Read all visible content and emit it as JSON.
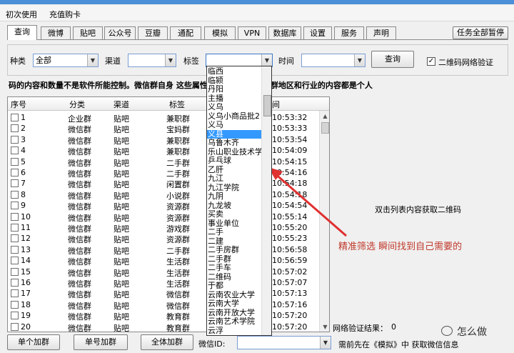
{
  "menu": [
    "初次使用",
    "充值购卡"
  ],
  "tabs": [
    "查询",
    "微博",
    "贴吧",
    "公众号",
    "豆瓣",
    "通配",
    "模拟",
    "VPN",
    "数据库",
    "设置",
    "服务",
    "声明"
  ],
  "pause_all_button": "任务全部暂停",
  "filters": {
    "type_label": "种类",
    "type_value": "全部",
    "channel_label": "渠道",
    "channel_value": "",
    "tag_label": "标签",
    "tag_value": "",
    "time_label": "时间",
    "time_value": "",
    "query_button": "查询",
    "qr_verify_label": "二维码网络验证",
    "qr_verify_checked": true
  },
  "notice": "码的内容和数量不是软件所能控制。微信群自身 这些属性标记的，那些标记群地区和行业的内容都是个人",
  "table": {
    "headers": [
      "序号",
      "分类",
      "渠道",
      "标签",
      "间"
    ],
    "rows": [
      [
        "1",
        "企业群",
        "贴吧",
        "兼职群",
        "10:53:32"
      ],
      [
        "2",
        "微信群",
        "贴吧",
        "宝妈群",
        "10:53:33"
      ],
      [
        "3",
        "微信群",
        "贴吧",
        "兼职群",
        "10:53:54"
      ],
      [
        "4",
        "微信群",
        "贴吧",
        "兼职群",
        "10:54:09"
      ],
      [
        "5",
        "微信群",
        "贴吧",
        "二手群",
        "10:54:15"
      ],
      [
        "6",
        "微信群",
        "贴吧",
        "二手群",
        "10:54:16"
      ],
      [
        "7",
        "微信群",
        "贴吧",
        "闲置群",
        "10:54:18"
      ],
      [
        "8",
        "微信群",
        "贴吧",
        "小说群",
        "10:54:18"
      ],
      [
        "9",
        "微信群",
        "贴吧",
        "资源群",
        "10:54:54"
      ],
      [
        "10",
        "微信群",
        "贴吧",
        "资源群",
        "10:55:14"
      ],
      [
        "11",
        "微信群",
        "贴吧",
        "游戏群",
        "10:55:20"
      ],
      [
        "12",
        "微信群",
        "贴吧",
        "资源群",
        "10:55:23"
      ],
      [
        "13",
        "微信群",
        "贴吧",
        "二手群",
        "10:56:58"
      ],
      [
        "14",
        "微信群",
        "贴吧",
        "生活群",
        "10:56:59"
      ],
      [
        "15",
        "微信群",
        "贴吧",
        "生活群",
        "10:57:02"
      ],
      [
        "16",
        "微信群",
        "贴吧",
        "生活群",
        "10:57:07"
      ],
      [
        "17",
        "微信群",
        "贴吧",
        "微信群",
        "10:57:13"
      ],
      [
        "18",
        "微信群",
        "贴吧",
        "微信群",
        "10:57:16"
      ],
      [
        "19",
        "微信群",
        "贴吧",
        "教育群",
        "10:57:20"
      ],
      [
        "20",
        "微信群",
        "贴吧",
        "教育群",
        "10:57:20"
      ]
    ]
  },
  "tag_dropdown_items": [
    "临西",
    "临颍",
    "丹阳",
    "主播",
    "义乌",
    "义乌小商品批2",
    "义马",
    "义县",
    "乌鲁木齐",
    "乐山职业技术学",
    "乒乓球",
    "乙肝",
    "九江",
    "九江学院",
    "九阴",
    "九龙坡",
    "买卖",
    "事业单位",
    "二手",
    "二建",
    "二手房群",
    "二手群",
    "二手车",
    "二维码",
    "于都",
    "云南农业大学",
    "云南大学",
    "云南开放大学",
    "云南艺术学院",
    "云浮"
  ],
  "tag_dropdown_selected": 7,
  "annotation_red": "精准筛选 瞬间找到自己需要的",
  "annotation_black": "双击列表内容获取二维码",
  "bottom": {
    "single_add": "单个加群",
    "batch_add": "单号加群",
    "all_add": "全体加群",
    "wechat_id_label": "微信ID:",
    "verify_result_label": "网络验证结果：",
    "verify_result_value": "0",
    "hint": "需前先在《模拟》中 获取微信信息"
  },
  "watermark": "怎么做"
}
